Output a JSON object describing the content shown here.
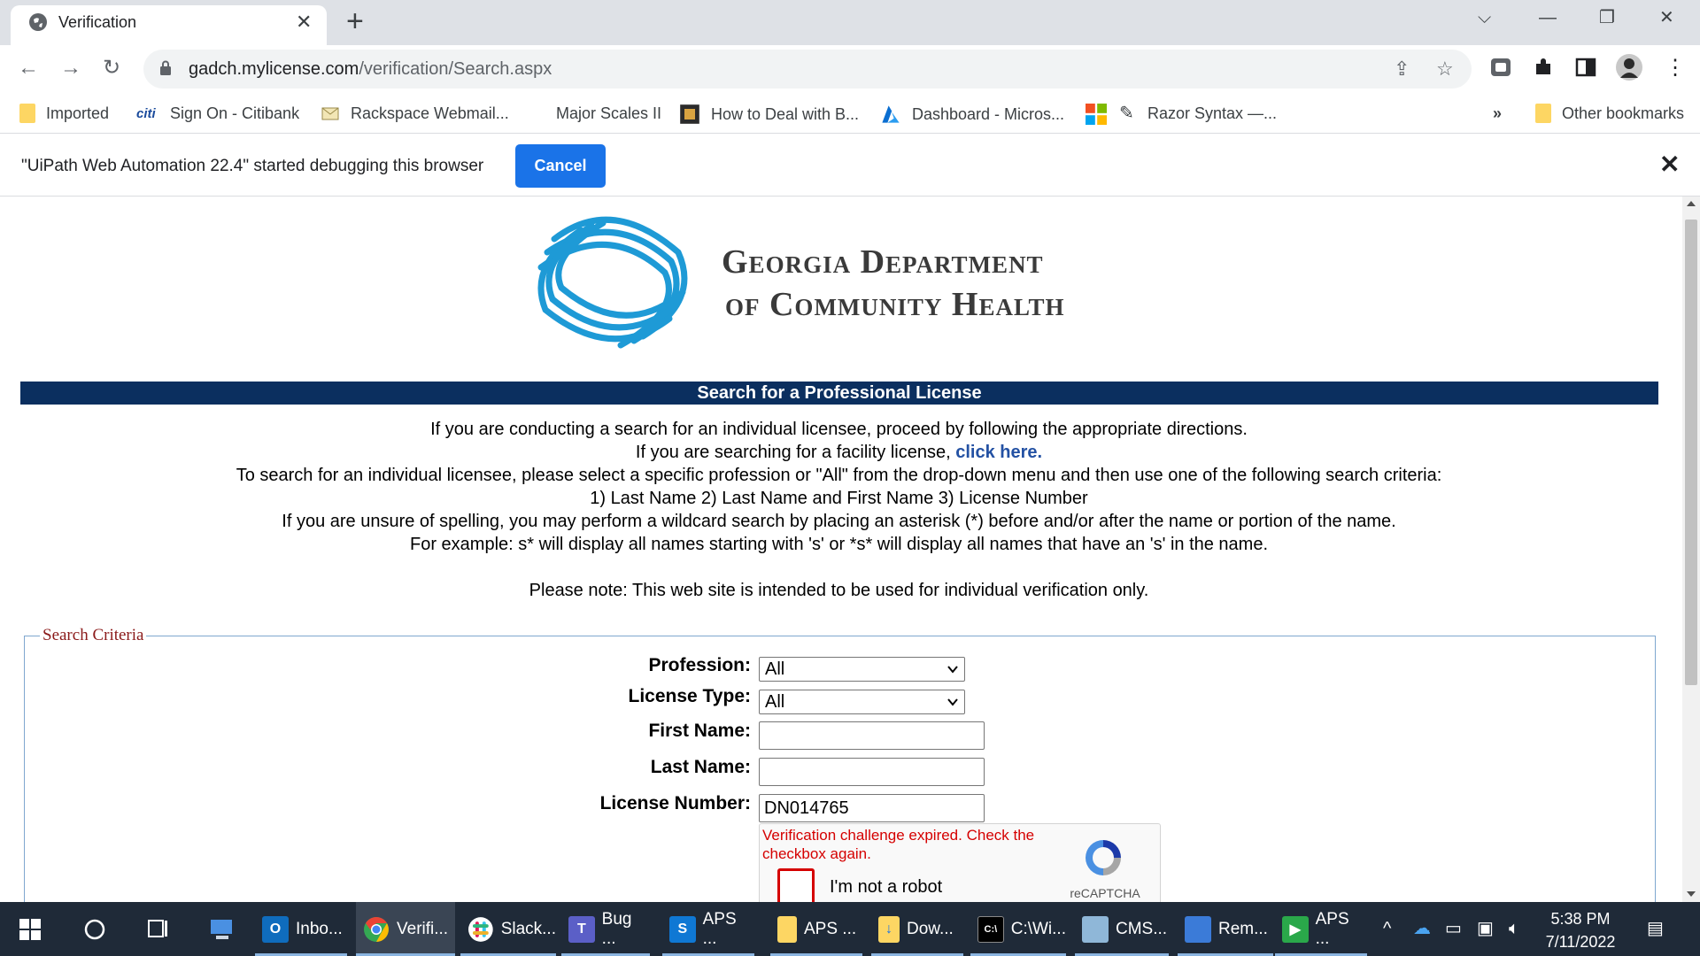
{
  "browser": {
    "tab_title": "Verification",
    "url_host": "gadch.mylicense.com",
    "url_path": "/verification/Search.aspx"
  },
  "bookmarks": [
    {
      "label": "Imported",
      "icon": "folder-icon"
    },
    {
      "label": "Sign On - Citibank",
      "icon": "citi-icon"
    },
    {
      "label": "Rackspace Webmail...",
      "icon": "mail-icon"
    },
    {
      "label": "Major Scales II",
      "icon": ""
    },
    {
      "label": "How to Deal with B...",
      "icon": "book-icon"
    },
    {
      "label": "Dashboard - Micros...",
      "icon": "azure-icon"
    },
    {
      "label": "",
      "icon": "microsoft-icon"
    },
    {
      "label": "Razor Syntax —...",
      "icon": "pen-icon"
    }
  ],
  "bookmarks_more": "»",
  "other_bookmarks": "Other bookmarks",
  "infobar": {
    "message": "\"UiPath Web Automation 22.4\" started debugging this browser",
    "cancel_label": "Cancel"
  },
  "page": {
    "org_line1": "Georgia Department",
    "org_line2": "of Community Health",
    "title": "Search for a Professional License",
    "instructions": {
      "line1": "If you are conducting a search for an individual licensee, proceed by following the appropriate directions.",
      "line2_prefix": "If you are searching for a facility license,",
      "line2_link": "click here.",
      "line3": "To search for an individual licensee, please select a specific profession or \"All\" from the drop-down menu and then use one of the following search criteria:",
      "line4": "1) Last Name 2) Last Name and First Name 3) License Number",
      "line5": "If you are unsure of spelling, you may perform a wildcard search by placing an asterisk (*) before and/or after the name or portion of the name.",
      "line6": "For example: s* will display all names starting with 's' or *s* will display all names that have an 's' in the name.",
      "note": "Please note: This web site is intended to be used for individual verification only."
    },
    "search_criteria": {
      "legend": "Search Criteria",
      "profession_label": "Profession:",
      "profession_value": "All",
      "license_type_label": "License Type:",
      "license_type_value": "All",
      "first_name_label": "First Name:",
      "first_name_value": "",
      "last_name_label": "Last Name:",
      "last_name_value": "",
      "license_number_label": "License Number:",
      "license_number_value": "DN014765"
    },
    "captcha": {
      "error": "Verification challenge expired. Check the checkbox again.",
      "checkbox_label": "I'm not a robot",
      "brand": "reCAPTCHA"
    }
  },
  "taskbar": {
    "items": [
      {
        "label": "Inbo...",
        "icon": "outlook-icon",
        "color": "#0f6cbd"
      },
      {
        "label": "Verifi...",
        "icon": "chrome-icon",
        "color": "#ffffff"
      },
      {
        "label": "Slack...",
        "icon": "slack-icon",
        "color": "#ffffff"
      },
      {
        "label": "Bug ...",
        "icon": "teams-icon",
        "color": "#5b5fc7"
      },
      {
        "label": "APS ...",
        "icon": "sharepoint-icon",
        "color": "#0f78d4"
      },
      {
        "label": "APS ...",
        "icon": "folder-icon",
        "color": "#fdd663"
      },
      {
        "label": "Dow...",
        "icon": "folder-download-icon",
        "color": "#fdd663"
      },
      {
        "label": "C:\\Wi...",
        "icon": "terminal-icon",
        "color": "#000000"
      },
      {
        "label": "CMS...",
        "icon": "cms-icon",
        "color": "#8fb7d8"
      },
      {
        "label": "Rem...",
        "icon": "remote-desktop-icon",
        "color": "#3b7bd8"
      },
      {
        "label": "APS ...",
        "icon": "uipath-icon",
        "color": "#2aa84a"
      }
    ],
    "time": "5:38 PM",
    "date": "7/11/2022"
  }
}
